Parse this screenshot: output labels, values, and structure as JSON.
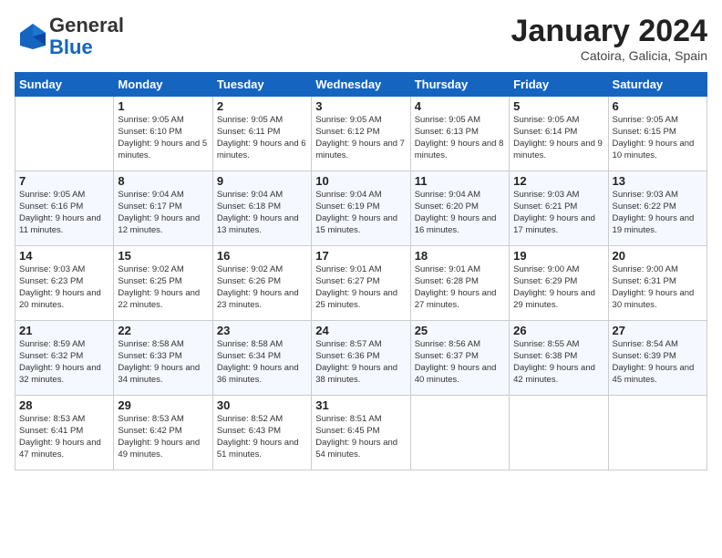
{
  "logo": {
    "line1": "General",
    "line2": "Blue"
  },
  "header": {
    "month": "January 2024",
    "location": "Catoira, Galicia, Spain"
  },
  "weekdays": [
    "Sunday",
    "Monday",
    "Tuesday",
    "Wednesday",
    "Thursday",
    "Friday",
    "Saturday"
  ],
  "weeks": [
    [
      {
        "day": "",
        "sunrise": "",
        "sunset": "",
        "daylight": ""
      },
      {
        "day": "1",
        "sunrise": "Sunrise: 9:05 AM",
        "sunset": "Sunset: 6:10 PM",
        "daylight": "Daylight: 9 hours and 5 minutes."
      },
      {
        "day": "2",
        "sunrise": "Sunrise: 9:05 AM",
        "sunset": "Sunset: 6:11 PM",
        "daylight": "Daylight: 9 hours and 6 minutes."
      },
      {
        "day": "3",
        "sunrise": "Sunrise: 9:05 AM",
        "sunset": "Sunset: 6:12 PM",
        "daylight": "Daylight: 9 hours and 7 minutes."
      },
      {
        "day": "4",
        "sunrise": "Sunrise: 9:05 AM",
        "sunset": "Sunset: 6:13 PM",
        "daylight": "Daylight: 9 hours and 8 minutes."
      },
      {
        "day": "5",
        "sunrise": "Sunrise: 9:05 AM",
        "sunset": "Sunset: 6:14 PM",
        "daylight": "Daylight: 9 hours and 9 minutes."
      },
      {
        "day": "6",
        "sunrise": "Sunrise: 9:05 AM",
        "sunset": "Sunset: 6:15 PM",
        "daylight": "Daylight: 9 hours and 10 minutes."
      }
    ],
    [
      {
        "day": "7",
        "sunrise": "Sunrise: 9:05 AM",
        "sunset": "Sunset: 6:16 PM",
        "daylight": "Daylight: 9 hours and 11 minutes."
      },
      {
        "day": "8",
        "sunrise": "Sunrise: 9:04 AM",
        "sunset": "Sunset: 6:17 PM",
        "daylight": "Daylight: 9 hours and 12 minutes."
      },
      {
        "day": "9",
        "sunrise": "Sunrise: 9:04 AM",
        "sunset": "Sunset: 6:18 PM",
        "daylight": "Daylight: 9 hours and 13 minutes."
      },
      {
        "day": "10",
        "sunrise": "Sunrise: 9:04 AM",
        "sunset": "Sunset: 6:19 PM",
        "daylight": "Daylight: 9 hours and 15 minutes."
      },
      {
        "day": "11",
        "sunrise": "Sunrise: 9:04 AM",
        "sunset": "Sunset: 6:20 PM",
        "daylight": "Daylight: 9 hours and 16 minutes."
      },
      {
        "day": "12",
        "sunrise": "Sunrise: 9:03 AM",
        "sunset": "Sunset: 6:21 PM",
        "daylight": "Daylight: 9 hours and 17 minutes."
      },
      {
        "day": "13",
        "sunrise": "Sunrise: 9:03 AM",
        "sunset": "Sunset: 6:22 PM",
        "daylight": "Daylight: 9 hours and 19 minutes."
      }
    ],
    [
      {
        "day": "14",
        "sunrise": "Sunrise: 9:03 AM",
        "sunset": "Sunset: 6:23 PM",
        "daylight": "Daylight: 9 hours and 20 minutes."
      },
      {
        "day": "15",
        "sunrise": "Sunrise: 9:02 AM",
        "sunset": "Sunset: 6:25 PM",
        "daylight": "Daylight: 9 hours and 22 minutes."
      },
      {
        "day": "16",
        "sunrise": "Sunrise: 9:02 AM",
        "sunset": "Sunset: 6:26 PM",
        "daylight": "Daylight: 9 hours and 23 minutes."
      },
      {
        "day": "17",
        "sunrise": "Sunrise: 9:01 AM",
        "sunset": "Sunset: 6:27 PM",
        "daylight": "Daylight: 9 hours and 25 minutes."
      },
      {
        "day": "18",
        "sunrise": "Sunrise: 9:01 AM",
        "sunset": "Sunset: 6:28 PM",
        "daylight": "Daylight: 9 hours and 27 minutes."
      },
      {
        "day": "19",
        "sunrise": "Sunrise: 9:00 AM",
        "sunset": "Sunset: 6:29 PM",
        "daylight": "Daylight: 9 hours and 29 minutes."
      },
      {
        "day": "20",
        "sunrise": "Sunrise: 9:00 AM",
        "sunset": "Sunset: 6:31 PM",
        "daylight": "Daylight: 9 hours and 30 minutes."
      }
    ],
    [
      {
        "day": "21",
        "sunrise": "Sunrise: 8:59 AM",
        "sunset": "Sunset: 6:32 PM",
        "daylight": "Daylight: 9 hours and 32 minutes."
      },
      {
        "day": "22",
        "sunrise": "Sunrise: 8:58 AM",
        "sunset": "Sunset: 6:33 PM",
        "daylight": "Daylight: 9 hours and 34 minutes."
      },
      {
        "day": "23",
        "sunrise": "Sunrise: 8:58 AM",
        "sunset": "Sunset: 6:34 PM",
        "daylight": "Daylight: 9 hours and 36 minutes."
      },
      {
        "day": "24",
        "sunrise": "Sunrise: 8:57 AM",
        "sunset": "Sunset: 6:36 PM",
        "daylight": "Daylight: 9 hours and 38 minutes."
      },
      {
        "day": "25",
        "sunrise": "Sunrise: 8:56 AM",
        "sunset": "Sunset: 6:37 PM",
        "daylight": "Daylight: 9 hours and 40 minutes."
      },
      {
        "day": "26",
        "sunrise": "Sunrise: 8:55 AM",
        "sunset": "Sunset: 6:38 PM",
        "daylight": "Daylight: 9 hours and 42 minutes."
      },
      {
        "day": "27",
        "sunrise": "Sunrise: 8:54 AM",
        "sunset": "Sunset: 6:39 PM",
        "daylight": "Daylight: 9 hours and 45 minutes."
      }
    ],
    [
      {
        "day": "28",
        "sunrise": "Sunrise: 8:53 AM",
        "sunset": "Sunset: 6:41 PM",
        "daylight": "Daylight: 9 hours and 47 minutes."
      },
      {
        "day": "29",
        "sunrise": "Sunrise: 8:53 AM",
        "sunset": "Sunset: 6:42 PM",
        "daylight": "Daylight: 9 hours and 49 minutes."
      },
      {
        "day": "30",
        "sunrise": "Sunrise: 8:52 AM",
        "sunset": "Sunset: 6:43 PM",
        "daylight": "Daylight: 9 hours and 51 minutes."
      },
      {
        "day": "31",
        "sunrise": "Sunrise: 8:51 AM",
        "sunset": "Sunset: 6:45 PM",
        "daylight": "Daylight: 9 hours and 54 minutes."
      },
      {
        "day": "",
        "sunrise": "",
        "sunset": "",
        "daylight": ""
      },
      {
        "day": "",
        "sunrise": "",
        "sunset": "",
        "daylight": ""
      },
      {
        "day": "",
        "sunrise": "",
        "sunset": "",
        "daylight": ""
      }
    ]
  ]
}
